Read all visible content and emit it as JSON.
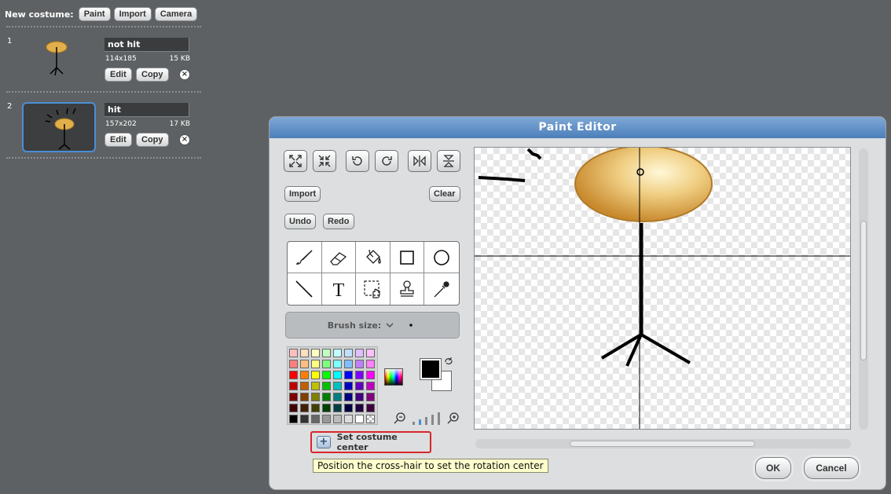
{
  "costumes_panel": {
    "new_costume_label": "New costume:",
    "buttons": {
      "paint": "Paint",
      "import": "Import",
      "camera": "Camera"
    },
    "costumes": [
      {
        "number": "1",
        "name": "not hit",
        "dimensions": "114x185",
        "size": "15 KB",
        "edit": "Edit",
        "copy": "Copy",
        "delete": "×"
      },
      {
        "number": "2",
        "name": "hit",
        "dimensions": "157x202",
        "size": "17 KB",
        "edit": "Edit",
        "copy": "Copy",
        "delete": "×"
      }
    ]
  },
  "paint_editor": {
    "title": "Paint Editor",
    "transform_tools": [
      "grow-icon",
      "shrink-icon",
      "rotate-left-icon",
      "rotate-right-icon",
      "flip-horizontal-icon",
      "flip-vertical-icon"
    ],
    "import_label": "Import",
    "clear_label": "Clear",
    "undo_label": "Undo",
    "redo_label": "Redo",
    "drawing_tools": [
      "paintbrush-icon",
      "eraser-icon",
      "fill-bucket-icon",
      "rectangle-icon",
      "ellipse-icon",
      "line-icon",
      "text-icon",
      "select-icon",
      "stamp-icon",
      "eyedropper-icon"
    ],
    "brush_size_label": "Brush size:",
    "primary_color": "#000000",
    "secondary_color": "#ffffff",
    "palette": [
      "#ffbfbf",
      "#ffdfbf",
      "#ffffbf",
      "#bfffbf",
      "#bfffff",
      "#bfdfff",
      "#dfbfff",
      "#ffbfff",
      "#ff7f7f",
      "#ffbf7f",
      "#ffff7f",
      "#7fff7f",
      "#7fffff",
      "#7fbfff",
      "#bf7fff",
      "#ff7fff",
      "#ff0000",
      "#ff8000",
      "#ffff00",
      "#00ff00",
      "#00ffff",
      "#0000ff",
      "#8000ff",
      "#ff00ff",
      "#c00000",
      "#c06000",
      "#c0c000",
      "#00c000",
      "#00c0c0",
      "#0000c0",
      "#6000c0",
      "#c000c0",
      "#800000",
      "#804000",
      "#808000",
      "#008000",
      "#008080",
      "#000080",
      "#400080",
      "#800080",
      "#400000",
      "#402000",
      "#404000",
      "#004000",
      "#004040",
      "#000040",
      "#200040",
      "#400040",
      "#000000",
      "#333333",
      "#666666",
      "#999999",
      "#bbbbbb",
      "#dddddd",
      "#ffffff",
      "transparent"
    ],
    "set_center_label": "Set costume center",
    "tooltip": "Position the cross-hair to set the rotation center",
    "ok_label": "OK",
    "cancel_label": "Cancel"
  }
}
